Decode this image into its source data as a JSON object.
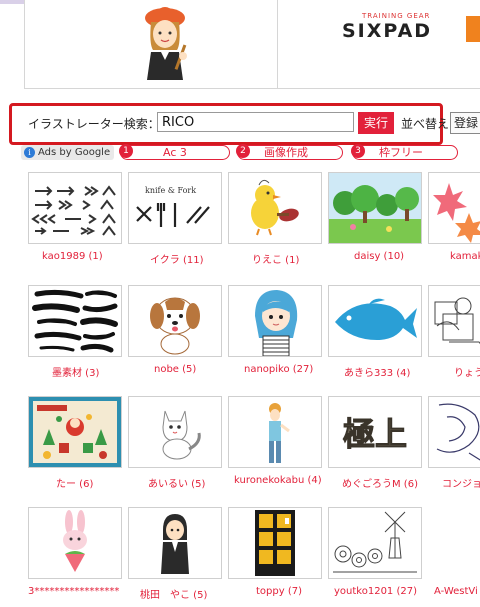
{
  "ad_banner": {
    "tagline": "TRAINING GEAR",
    "brand": "SIXPAD"
  },
  "search": {
    "label": "イラストレーター検索：",
    "value": "RICO",
    "submit_label": "実行",
    "sort_label": "並べ替え",
    "sort_value": "登録"
  },
  "ads": {
    "ads_by": "Ads by Google",
    "links": [
      {
        "num": "1",
        "label": "Ac 3"
      },
      {
        "num": "2",
        "label": "画像作成"
      },
      {
        "num": "3",
        "label": "枠フリー"
      }
    ]
  },
  "illustrators": [
    {
      "caption": "kao1989 (1)"
    },
    {
      "caption": "イクラ (11)"
    },
    {
      "caption": "りえこ (1)"
    },
    {
      "caption": "daisy (10)"
    },
    {
      "caption": "kamak"
    },
    {
      "caption": "墨素材 (3)"
    },
    {
      "caption": "nobe (5)"
    },
    {
      "caption": "nanopiko (27)"
    },
    {
      "caption": "あきら333 (4)"
    },
    {
      "caption": "りょう"
    },
    {
      "caption": "たー (6)"
    },
    {
      "caption": "あいるい (5)"
    },
    {
      "caption": "kuronekokabu (4)"
    },
    {
      "caption": "めぐごろうM (6)"
    },
    {
      "caption": "コンジョ"
    },
    {
      "caption": "3*****************"
    },
    {
      "caption": "桃田　やこ (5)"
    },
    {
      "caption": "toppy (7)"
    },
    {
      "caption": "youtko1201 (27)"
    },
    {
      "caption": "A-WestVi"
    }
  ],
  "thumb_text": {
    "knife_fork": "knife & Fork",
    "kanji": "極上"
  },
  "colors": {
    "accent": "#e2213a",
    "search_border": "#d41920"
  }
}
